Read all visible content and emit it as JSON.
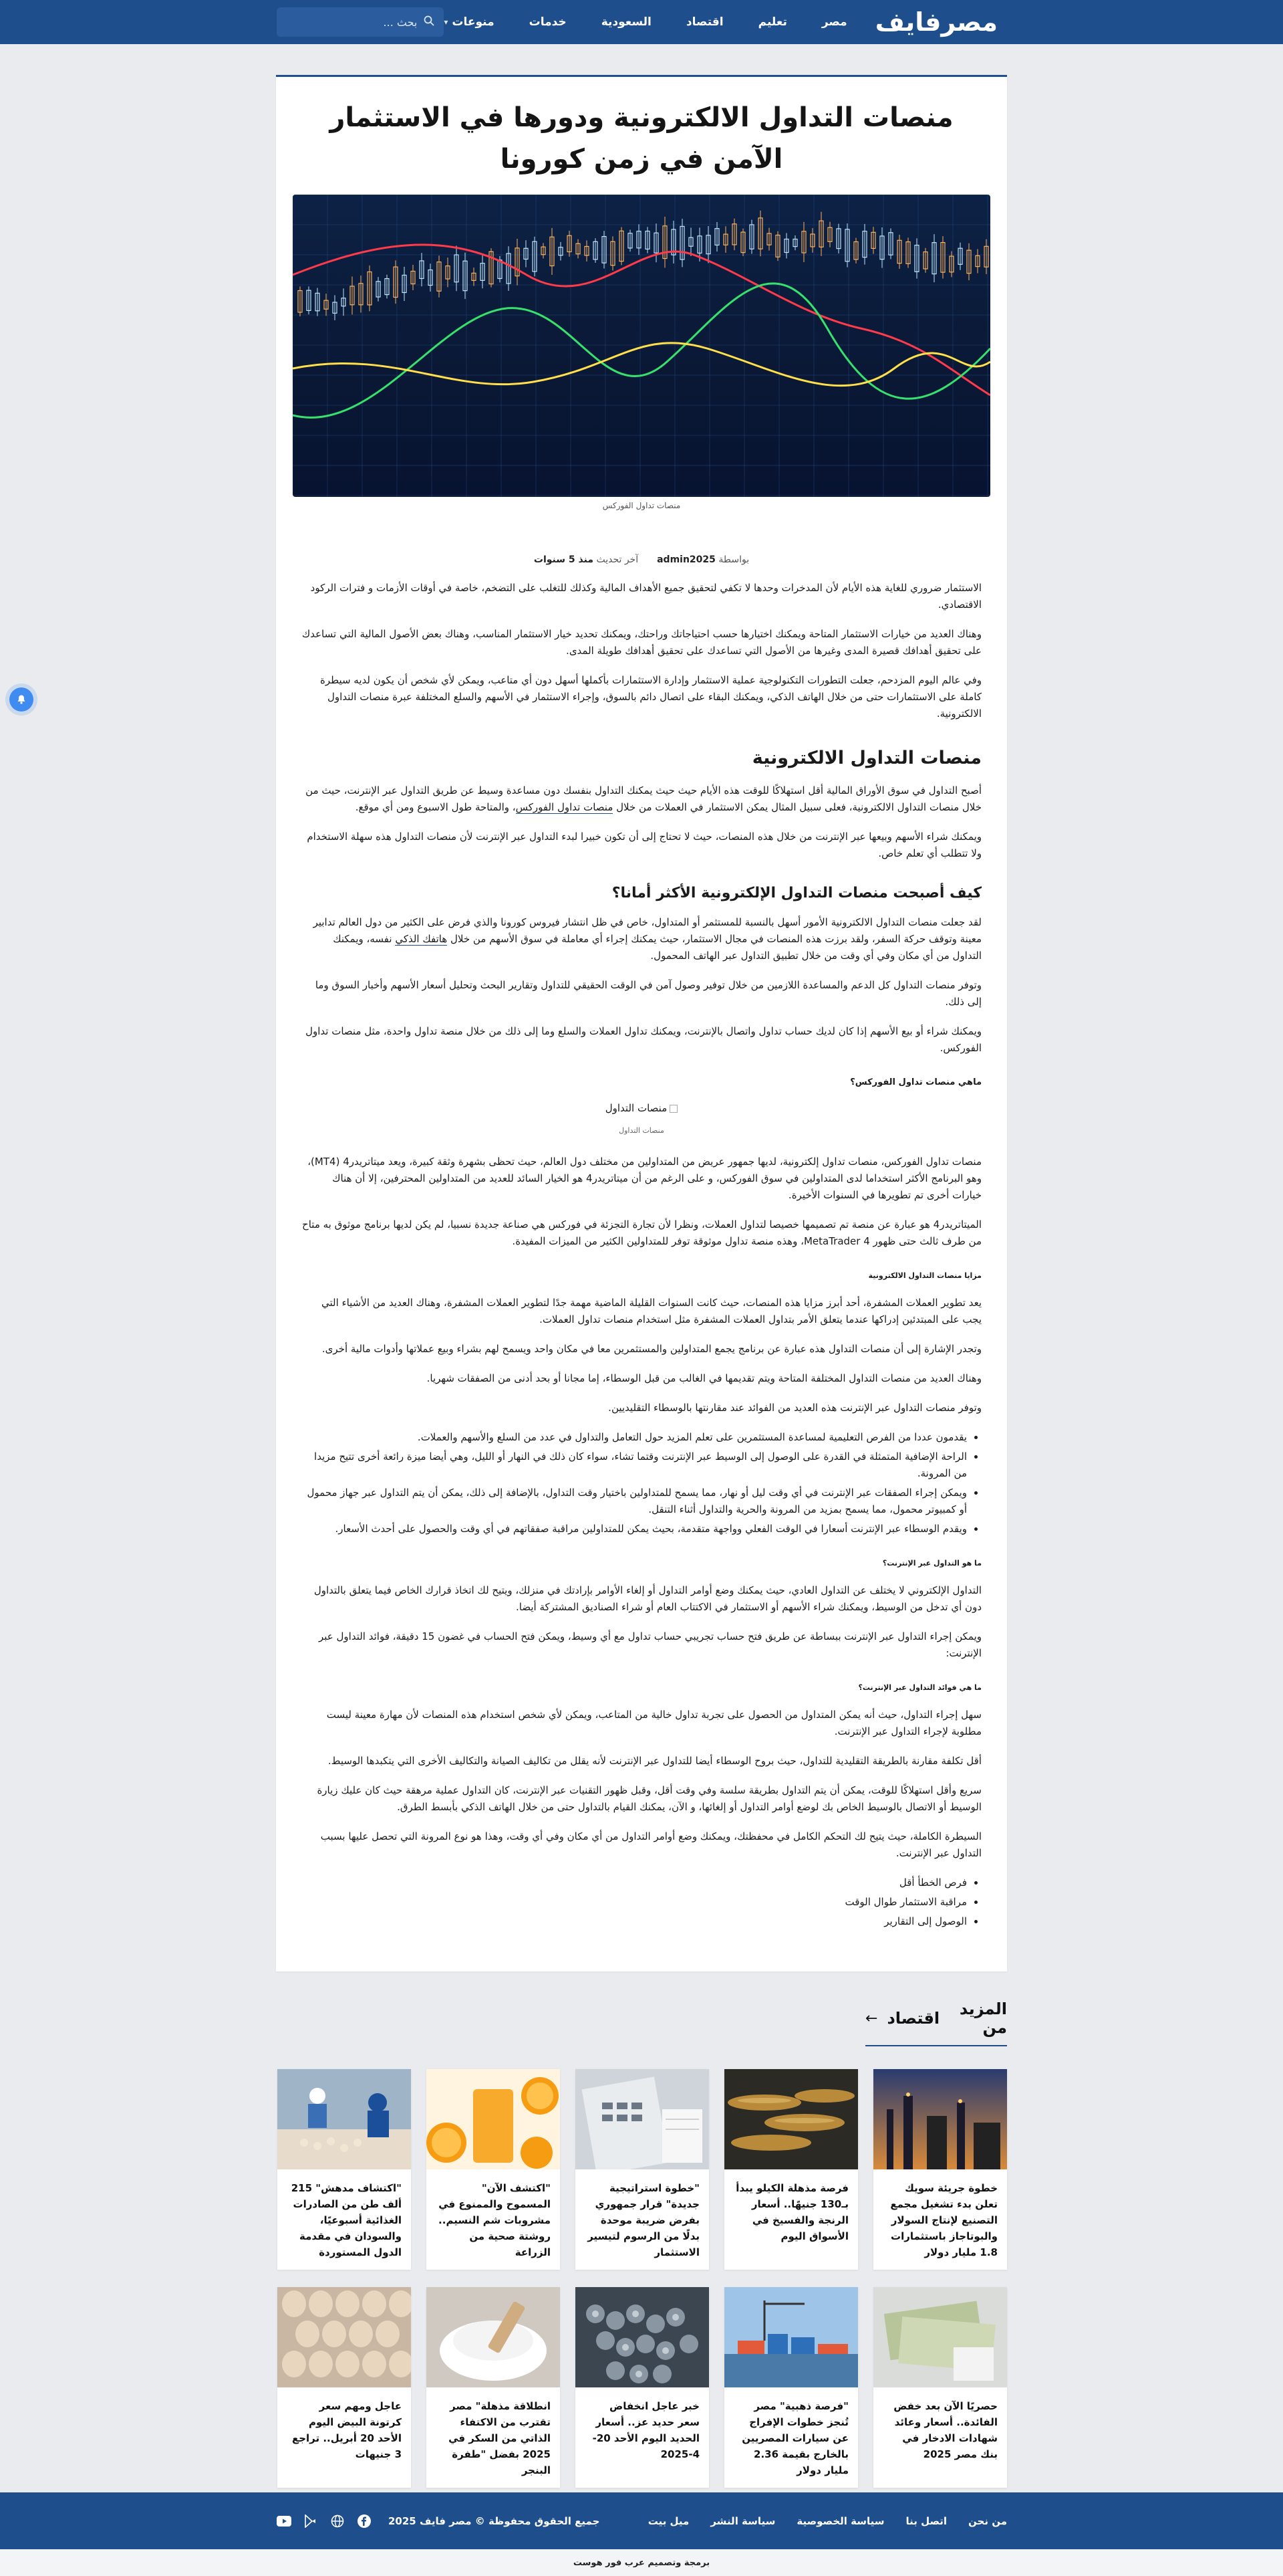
{
  "header": {
    "logo": "مصرفايف",
    "nav": [
      {
        "label": "مصر"
      },
      {
        "label": "تعليم"
      },
      {
        "label": "اقتصاد"
      },
      {
        "label": "السعودية"
      },
      {
        "label": "خدمات"
      },
      {
        "label": "منوعات"
      }
    ],
    "search_placeholder": "بحث ..."
  },
  "article": {
    "title": "منصات التداول الالكترونية ودورها في الاستثمار الآمن في زمن كورونا",
    "hero_caption": "منصات تداول الفوركس",
    "meta": {
      "by_label": "بواسطة",
      "author": "admin2025",
      "updated_label": "آخر تحديث",
      "updated": "منذ 5 سنوات"
    },
    "p1": "الاستثمار ضروري للغاية هذه الأيام لأن المدخرات وحدها لا تكفي لتحقيق جميع الأهداف المالية وكذلك للتغلب على التضخم، خاصة في أوقات الأزمات و فترات الركود الاقتصادي.",
    "p2": "وهناك العديد من خيارات الاستثمار المتاحة ويمكنك اختيارها حسب احتياجاتك وراحتك، ويمكنك تحديد خيار الاستثمار المناسب، وهناك بعض الأصول المالية التي تساعدك على تحقيق أهدافك قصيرة المدى وغيرها من الأصول التي تساعدك على تحقيق أهدافك طويلة المدى.",
    "p3": "وفي عالم اليوم المزدحم، جعلت التطورات التكنولوجية عملية الاستثمار وإدارة الاستثمارات بأكملها أسهل دون أي متاعب، ويمكن لأي شخص أن يكون لديه سيطرة كاملة على الاستثمارات حتى من خلال الهاتف الذكي، ويمكنك البقاء على اتصال دائم بالسوق، وإجراء الاستثمار في الأسهم والسلع المختلفة عبرة منصات التداول الالكترونية.",
    "h2_1": "منصات التداول الالكترونية",
    "p4a": "أصبح التداول في سوق الأوراق المالية أقل استهلاكًا للوقت هذه الأيام حيث حيث يمكنك التداول بنفسك دون مساعدة وسيط عن طريق التداول عبر الإنترنت، حيث من خلال منصات التداول الالكترونية، فعلى سبيل المثال يمكن الاستثمار في العملات من خلال ",
    "p4_link": "منصات تداول الفوركس",
    "p4b": "، والمتاحة طول الاسبوع ومن أي موقع.",
    "p5": "ويمكنك شراء الأسهم وبيعها عبر الإنترنت من خلال هذه المنصات، حيث لا تحتاج إلى أن تكون خبيرا لبدء التداول عبر الإنترنت لأن منصات التداول هذه سهلة الاستخدام ولا تتطلب أي تعلم خاص.",
    "h3_1": "كيف أصبحت منصات التداول الإلكترونية الأكثر أمانا؟",
    "p6a": "لقد جعلت منصات التداول الالكترونية الأمور أسهل بالنسبة للمستثمر أو المتداول، خاص في ظل انتشار فيروس كورونا والذي فرض على الكثير من دول العالم تدابير معينة وتوقف حركة السفر، ولقد برزت هذه المنصات في مجال الاستثمار، حيث يمكنك إجراء أي معاملة في سوق الأسهم من خلال ",
    "p6_link": "هاتفك الذكي",
    "p6b": " نفسه، ويمكنك التداول من أي مكان وفي أي وقت من خلال تطبيق التداول عبر الهاتف المحمول.",
    "p7": "وتوفر منصات التداول كل الدعم والمساعدة اللازمين من خلال توفير وصول آمن في الوقت الحقيقي للتداول وتقارير البحث وتحليل أسعار الأسهم وأخبار السوق وما إلى ذلك.",
    "p8": "ويمكنك شراء أو بيع الأسهم إذا كان لديك حساب تداول واتصال بالإنترنت، ويمكنك تداول العملات والسلع وما إلى ذلك من خلال منصة تداول واحدة، مثل منصات تداول الفوركس.",
    "h5_1": "ماهي منصات تداول الفوركس؟",
    "fig_alt": "منصات التداول",
    "fig_caption": "منصات التداول",
    "p9": "منصات تداول الفوركس، منصات تداول إلكترونية، لديها جمهور عريض من المتداولين من مختلف دول العالم، حيث تحظى بشهرة وثقة كبيرة، ويعد ميتاتريدر4 (MT4)، وهو البرنامج الأكثر استخداما لدى المتداولين في سوق الفوركس، و على الرغم من أن ميتاتريدر4 هو الخيار السائد للعديد من المتداولين المحترفين، إلا أن هناك خيارات أخرى تم تطويرها في السنوات الأخيرة.",
    "p10": "الميتاتريدر4 هو عبارة عن منصة تم تصميمها خصيصا لتداول العملات، ونظرا لأن تجارة التجزئة في فوركس هي صناعة جديدة نسبيا، لم يكن لديها برنامج موثوق به متاح من طرف ثالث حتى ظهور MetaTrader 4، وهذه منصة تداول موثوقة توفر للمتداولين الكثير من الميزات المفيدة.",
    "h6_1": "مزايا منصات التداول الالكترونية",
    "p11": "يعد تطوير العملات المشفرة، أحد أبرز مزايا هذه المنصات، حيث كانت السنوات القليلة الماضية مهمة جدًا لتطوير العملات المشفرة، وهناك العديد من الأشياء التي يجب على المبتدئين إدراكها عندما يتعلق الأمر بتداول العملات المشفرة مثل استخدام منصات تداول العملات.",
    "p12": "وتجدر الإشارة إلى أن منصات التداول هذه عبارة عن برنامج يجمع المتداولين والمستثمرين معا في مكان واحد ويسمح لهم بشراء وبيع عملاتها وأدوات مالية أخرى.",
    "p13": "وهناك العديد من منصات التداول المختلفة المتاحة ويتم تقديمها في الغالب من قبل الوسطاء، إما مجانا أو بحد أدنى من الصفقات شهريا.",
    "p14": "وتوفر منصات التداول عبر الإنترنت هذه العديد من الفوائد عند مقارنتها بالوسطاء التقليديين.",
    "list1": [
      "يقدمون عددا من الفرص التعليمية لمساعدة المستثمرين على تعلم المزيد حول التعامل والتداول في عدد من السلع والأسهم والعملات.",
      "الراحة الإضافية المتمثلة في القدرة على الوصول إلى الوسيط عبر الإنترنت وقتما تشاء، سواء كان ذلك في النهار أو الليل، وهي أيضا ميزة رائعة أخرى تتيح مزيدا من المرونة.",
      "ويمكن إجراء الصفقات عبر الإنترنت في أي وقت ليل أو نهار، مما يسمح للمتداولين باختيار وقت التداول، بالإضافة إلى ذلك، يمكن أن يتم التداول عبر جهاز محمول أو كمبيوتر محمول، مما يسمح بمزيد من المرونة والحرية والتداول أثناء التنقل.",
      "ويقدم الوسطاء عبر الإنترنت أسعارا في الوقت الفعلي وواجهة متقدمة، بحيث يمكن للمتداولين مراقبة صفقاتهم في أي وقت والحصول على أحدث الأسعار."
    ],
    "h6_2": "ما هو التداول عبر الإنترنت؟",
    "p15": "التداول الإلكتروني لا يختلف عن التداول العادي، حيث يمكنك وضع أوامر التداول أو إلغاء الأوامر بإرادتك في منزلك، ويتيح لك اتخاذ قرارك الخاص فيما يتعلق بالتداول دون أي تدخل من الوسيط، ويمكنك شراء الأسهم أو الاستثمار في الاكتتاب العام أو شراء الصناديق المشتركة أيضا.",
    "p16": "ويمكن إجراء التداول عبر الإنترنت ببساطة عن طريق فتح حساب تجريبي حساب تداول مع أي وسيط، ويمكن فتح الحساب في غضون 15 دقيقة، فوائد التداول عبر الإنترنت:",
    "h6_3": "ما هي فوائد التداول عبر الإنترنت؟",
    "p17": "سهل إجراء التداول، حيث أنه يمكن المتداول من الحصول على تجربة تداول خالية من المتاعب، ويمكن لأي شخص استخدام هذه المنصات لأن مهارة معينة ليست مطلوبة لإجراء التداول عبر الإنترنت.",
    "p18": "أقل تكلفة مقارنة بالطريقة التقليدية للتداول، حيث بروح الوسطاء أيضا للتداول عبر الإنترنت لأنه يقلل من تكاليف الصيانة والتكاليف الأخرى التي يتكبدها الوسيط.",
    "p19": "سريع وأقل استهلاكًا للوقت، يمكن أن يتم التداول بطريقة سلسة وفي وقت أقل، وقبل ظهور التقنيات عبر الإنترنت، كان التداول عملية مرهقة حيث كان عليك زيارة الوسيط أو الاتصال بالوسيط الخاص بك لوضع أوامر التداول أو إلغائها، و الآن، يمكنك القيام بالتداول حتى من خلال الهاتف الذكي بأبسط الطرق.",
    "p20": "السيطرة الكاملة، حيث يتيح لك التحكم الكامل في محفظتك، ويمكنك وضع أوامر التداول من أي مكان وفي أي وقت، وهذا هو نوع المرونة التي تحصل عليها بسبب التداول عبر الإنترنت.",
    "list2": [
      "فرص الخطأ أقل",
      "مراقبة الاستثمار طوال الوقت",
      "الوصول إلى التقارير"
    ]
  },
  "more": {
    "title_a": "المزيد من",
    "title_b": "اقتصاد",
    "cards": [
      {
        "title": "خطوة جريئة سويك تعلن بدء تشغيل مجمع التصنيع لإنتاج السولار والبوتاجاز باستثمارات 1.8 مليار دولار"
      },
      {
        "title": "فرصة مذهلة الكيلو يبدأ بـ130 جنيهًا.. أسعار الرنجة والفسيخ في الأسواق اليوم"
      },
      {
        "title": "\"خطوة استراتيجية جديدة\" قرار جمهوري بفرض ضريبة موحدة بدلًا من الرسوم لتيسير الاستثمار"
      },
      {
        "title": "\"اكتشف الآن\" المسموح والممنوع في مشروبات شم النسيم.. روشتة صحية من الزراعة"
      },
      {
        "title": "\"اكتشاف مدهش\" 215 ألف طن من الصادرات الغذائية أسبوعيًا، والسودان في مقدمة الدول المستوردة"
      },
      {
        "title": "حصريًا الآن بعد خفض الفائدة.. أسعار وعائد شهادات الادخار في بنك مصر 2025"
      },
      {
        "title": "\"فرصة ذهبية\" مصر تُنجز خطوات الإفراج عن سيارات المصريين بالخارج بقيمة 2.36 مليار دولار"
      },
      {
        "title": "خبر عاجل انخفاض سعر حديد عز.. أسعار الحديد اليوم الأحد 20-4-2025"
      },
      {
        "title": "انطلاقة مذهلة\" مصر تقترب من الاكتفاء الذاتي من السكر في 2025 بفضل \"طفرة البنجر"
      },
      {
        "title": "عاجل ومهم سعر كرتونة البيض اليوم الأحد 20 أبريل.. تراجع 3 جنيهات"
      }
    ]
  },
  "footer": {
    "links": [
      "من نحن",
      "اتصل بنا",
      "سياسة الخصوصية",
      "سياسة النشر",
      "ميل بيت"
    ],
    "copyright": "جميع الحقوق محفوظة © مصر فايف 2025",
    "credit": "برمجة وتصميم عرب فور هوست"
  }
}
